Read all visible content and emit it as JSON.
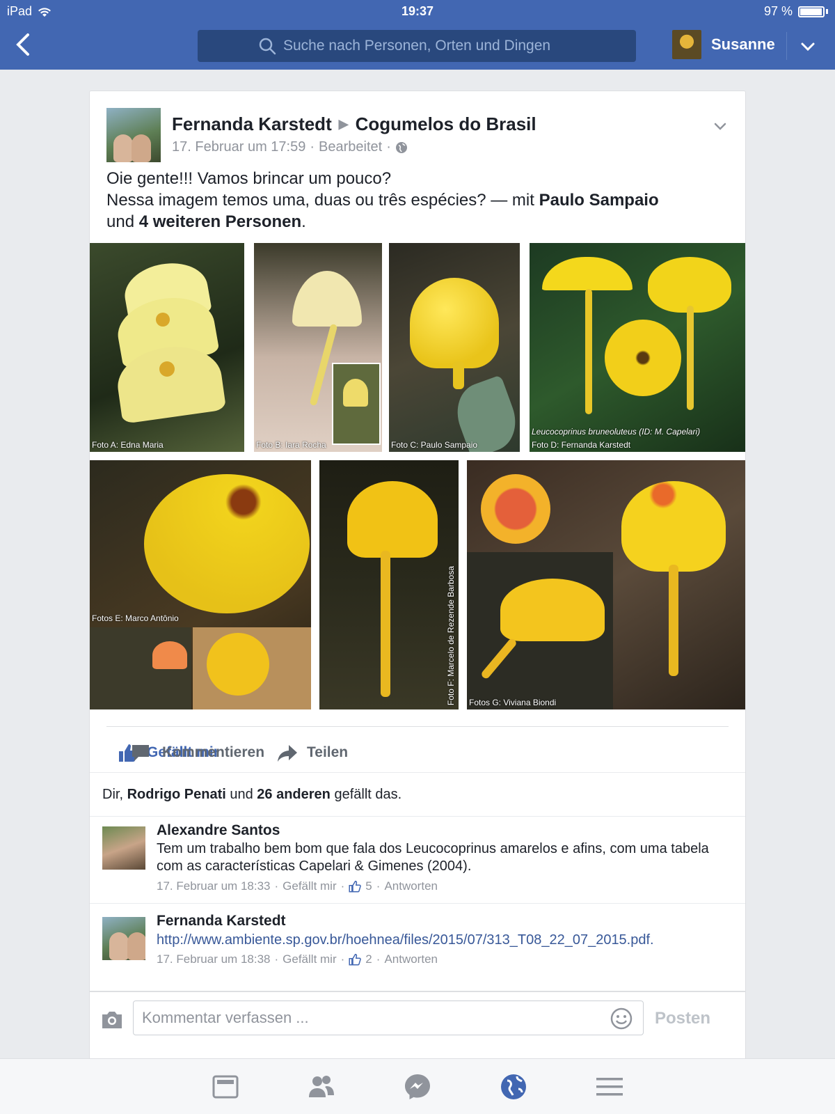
{
  "status_bar": {
    "carrier": "iPad",
    "time": "19:37",
    "battery_text": "97 %",
    "battery_level": 0.97
  },
  "header": {
    "search_placeholder": "Suche nach Personen, Orten und Dingen",
    "user_name": "Susanne",
    "icons": [
      "back-icon",
      "search-icon",
      "chevron-down-icon"
    ]
  },
  "post": {
    "author": "Fernanda Karstedt",
    "group": "Cogumelos do Brasil",
    "timestamp": "17. Februar um 17:59",
    "edited": "Bearbeitet",
    "line1": "Oie gente!!! Vamos brincar um pouco?",
    "line2_prefix": "Nessa imagem temos uma, duas ou três espécies? — mit ",
    "tagged_person": "Paulo Sampaio",
    "line3_and": "und ",
    "tagged_others": "4 weiteren Personen",
    "line3_end": ".",
    "photo_captions": {
      "a": "Foto A: Edna Maria",
      "b": "Foto B: Iara Rocha",
      "c": "Foto C: Paulo Sampaio",
      "d_species": "Leucocoprinus bruneoluteus (ID: M. Capelari)",
      "d": "Foto D: Fernanda Karstedt",
      "e": "Fotos E: Marco Antônio",
      "f": "Foto F: Marcelo de Rezende Barbosa",
      "g": "Fotos G: Viviana Biondi"
    }
  },
  "actions": {
    "like": "Gefällt mir",
    "comment": "Kommentieren",
    "share": "Teilen"
  },
  "likes": {
    "prefix": "Dir, ",
    "name": "Rodrigo Penati",
    "middle": " und ",
    "others": "26 anderen",
    "suffix": " gefällt das."
  },
  "comments": [
    {
      "author": "Alexandre Santos",
      "text": "Tem um trabalho bem bom que fala dos Leucocoprinus amarelos e afins, com uma tabela com as características  Capelari & Gimenes (2004).",
      "time": "17. Februar um 18:33",
      "like_label": "Gefällt mir",
      "like_count": "5",
      "reply_label": "Antworten"
    },
    {
      "author": "Fernanda Karstedt",
      "link": "http://www.ambiente.sp.gov.br/hoehnea/files/2015/07/313_T08_22_07_2015.pdf",
      "link_end": ".",
      "time": "17. Februar um 18:38",
      "like_label": "Gefällt mir",
      "like_count": "2",
      "reply_label": "Antworten"
    }
  ],
  "composer": {
    "placeholder": "Kommentar verfassen ...",
    "post_label": "Posten"
  },
  "tabbar": [
    "news-feed-icon",
    "friends-icon",
    "messenger-icon",
    "notifications-globe-icon",
    "menu-icon"
  ],
  "colors": {
    "brand": "#4267b2",
    "link": "#385898",
    "mushroom_yellow": "#f2c822"
  }
}
